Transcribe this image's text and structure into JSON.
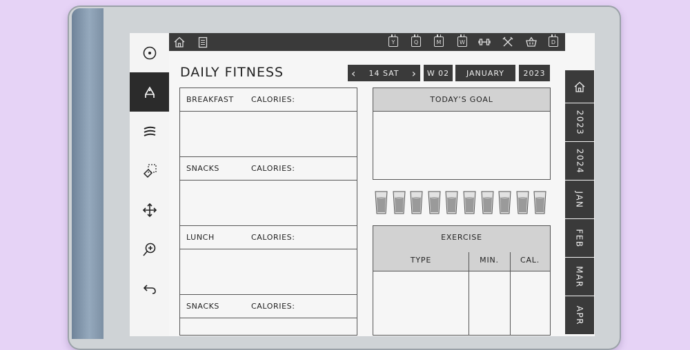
{
  "page": {
    "title": "DAILY FITNESS"
  },
  "header": {
    "prev": "‹",
    "day": "14 SAT",
    "next": "›",
    "week": "W 02",
    "month": "JANUARY",
    "year": "2023"
  },
  "topbar": {
    "icons": [
      "home-icon",
      "notes-icon"
    ],
    "letters": [
      "Y",
      "Q",
      "M",
      "W"
    ],
    "end_letter": "D",
    "extra_icons": [
      "dumbbell-icon",
      "fork-knife-icon",
      "basket-icon"
    ]
  },
  "toolbar": {
    "tools": [
      "circle-menu-icon",
      "pen-icon",
      "lines-icon",
      "eraser-icon",
      "move-icon",
      "zoom-icon",
      "undo-icon"
    ]
  },
  "right_tabs": [
    "2023",
    "2024",
    "JAN",
    "FEB",
    "MAR",
    "APR"
  ],
  "meals": [
    {
      "name": "BREAKFAST",
      "calories_label": "CALORIES:"
    },
    {
      "name": "SNACKS",
      "calories_label": "CALORIES:"
    },
    {
      "name": "LUNCH",
      "calories_label": "CALORIES:"
    },
    {
      "name": "SNACKS",
      "calories_label": "CALORIES:"
    }
  ],
  "goal": {
    "title": "TODAY’S GOAL"
  },
  "water": {
    "glasses": 10
  },
  "exercise": {
    "title": "EXERCISE",
    "columns": [
      "TYPE",
      "MIN.",
      "CAL."
    ]
  },
  "colors": {
    "background": "#e6d3f6",
    "dark": "#3a3a3a",
    "header_gray": "#d2d2d2"
  }
}
